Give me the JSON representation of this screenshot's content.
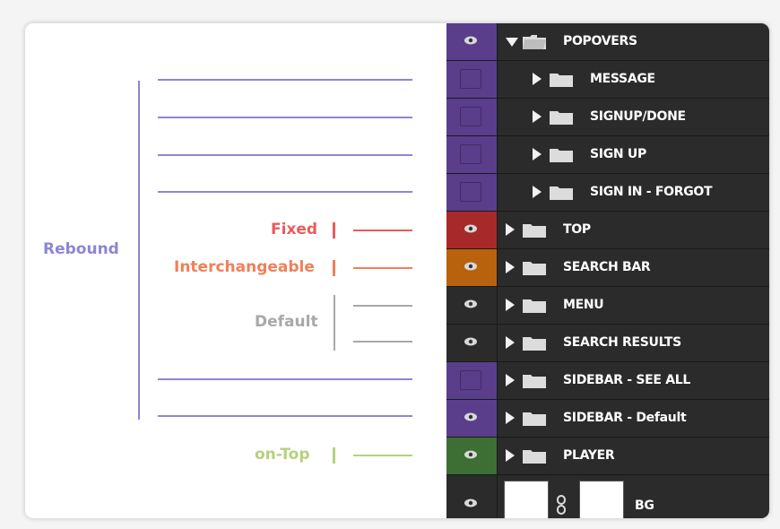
{
  "annotations": {
    "rebound": {
      "label": "Rebound",
      "color": "#8c86d4"
    },
    "fixed": {
      "label": "Fixed",
      "color": "#ea5b5b"
    },
    "interchangeable": {
      "label": "Interchangeable",
      "color": "#f0805a"
    },
    "default": {
      "label": "Default",
      "color": "#a8a8a8"
    },
    "on_top": {
      "label": "on-Top",
      "color": "#b5d17e"
    }
  },
  "layers": [
    {
      "name": "POPOVERS",
      "eye": "visible",
      "swatch": "#5a3e8c",
      "expanded": true,
      "indent": 0
    },
    {
      "name": "MESSAGE",
      "eye": "hidden",
      "swatch": "#5a3e8c",
      "expanded": false,
      "indent": 1
    },
    {
      "name": "SIGNUP/DONE",
      "eye": "hidden",
      "swatch": "#5a3e8c",
      "expanded": false,
      "indent": 1
    },
    {
      "name": "SIGN UP",
      "eye": "hidden",
      "swatch": "#5a3e8c",
      "expanded": false,
      "indent": 1
    },
    {
      "name": "SIGN IN - FORGOT",
      "eye": "hidden",
      "swatch": "#5a3e8c",
      "expanded": false,
      "indent": 1
    },
    {
      "name": "TOP",
      "eye": "visible",
      "swatch": "#a8292a",
      "expanded": false,
      "indent": 0
    },
    {
      "name": "SEARCH BAR",
      "eye": "visible",
      "swatch": "#b8620d",
      "expanded": false,
      "indent": 0
    },
    {
      "name": "MENU",
      "eye": "visible",
      "swatch": "#2b2b2b",
      "expanded": false,
      "indent": 0
    },
    {
      "name": "SEARCH RESULTS",
      "eye": "visible",
      "swatch": "#2b2b2b",
      "expanded": false,
      "indent": 0
    },
    {
      "name": "SIDEBAR - SEE ALL",
      "eye": "hidden",
      "swatch": "#5a3e8c",
      "expanded": false,
      "indent": 0
    },
    {
      "name": "SIDEBAR - Default",
      "eye": "visible",
      "swatch": "#5a3e8c",
      "expanded": false,
      "indent": 0
    },
    {
      "name": "PLAYER",
      "eye": "visible",
      "swatch": "#3d6e33",
      "expanded": false,
      "indent": 0
    }
  ],
  "bg_layer": {
    "name": "BG",
    "eye": "visible",
    "link_icon": "chain-link-icon"
  },
  "icons": {
    "eye": "eye-icon",
    "folder": "folder-icon",
    "expand": "triangle-right-icon",
    "collapse": "triangle-down-icon"
  }
}
